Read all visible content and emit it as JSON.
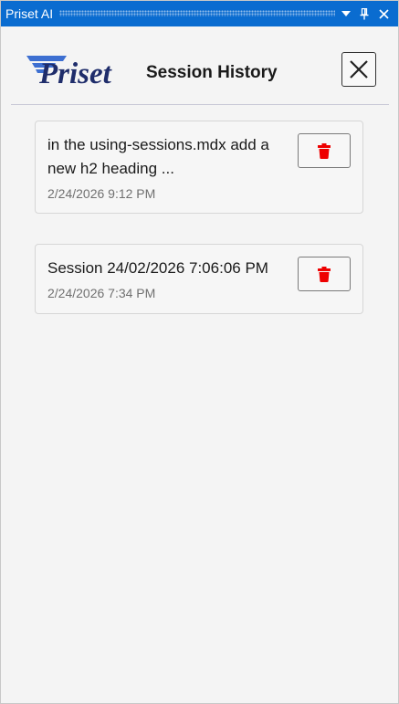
{
  "window": {
    "title": "Priset AI"
  },
  "header": {
    "logo_text": "Priset",
    "title": "Session History"
  },
  "sessions": [
    {
      "title": "in the using-sessions.mdx add a new h2 heading ...",
      "date": "2/24/2026 9:12 PM"
    },
    {
      "title": "Session 24/02/2026 7:06:06 PM",
      "date": "2/24/2026 7:34 PM"
    }
  ],
  "icons": {
    "dropdown": "chevron-down-icon",
    "pin": "pin-icon",
    "close_window": "close-icon",
    "close_panel": "close-icon",
    "delete": "trash-icon"
  },
  "colors": {
    "titlebar": "#0a6cd0",
    "logo_primary": "#1f2d6b",
    "logo_accent": "#3d6fd1",
    "delete_icon": "#ee0000"
  }
}
